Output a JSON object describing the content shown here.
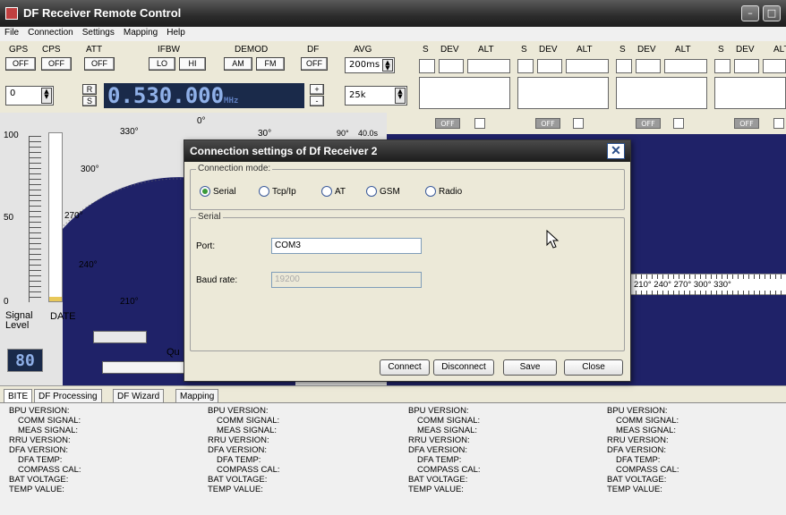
{
  "window": {
    "title": "DF Receiver Remote Control"
  },
  "menu": [
    "File",
    "Connection",
    "Settings",
    "Mapping",
    "Help"
  ],
  "toolbar": {
    "labels": [
      "GPS",
      "CPS",
      "ATT",
      "IFBW",
      "DEMOD",
      "DF",
      "AVG"
    ],
    "gps_btn": "OFF",
    "cps_btn": "OFF",
    "att_btn": "OFF",
    "lo": "LO",
    "hi": "HI",
    "am": "AM",
    "fm": "FM",
    "df_btn": "OFF",
    "avg_value": "200ms",
    "channel_value": "0",
    "r_label": "R",
    "s_label": "S",
    "frequency": "0.530.000",
    "freq_unit": "MHz",
    "step_value": "25k",
    "plus": "+",
    "minus": "-"
  },
  "channels": {
    "headers": [
      "S",
      "DEV",
      "ALT"
    ],
    "off_label": "OFF"
  },
  "compass": {
    "deg_0": "0°",
    "deg_30": "30°",
    "deg_330": "330°",
    "deg_300": "300°",
    "deg_270": "270°",
    "deg_240": "240°",
    "deg_210": "210°",
    "deg_90": "90°",
    "time": "40.0s"
  },
  "level": {
    "scale_100": "100",
    "scale_50": "50",
    "scale_0": "0",
    "signal_label": "Signal\nLevel",
    "date_label": "DATE",
    "level_value": "80",
    "quality_label": "Qu"
  },
  "scale_strip": "210° 240° 270° 300° 330°",
  "tabs": [
    "BITE",
    "DF Processing",
    "DF Wizard",
    "Mapping"
  ],
  "bite": {
    "lines": [
      "BPU VERSION:",
      "COMM SIGNAL:",
      "MEAS SIGNAL:",
      "RRU VERSION:",
      "DFA VERSION:",
      "DFA TEMP:",
      "COMPASS CAL:",
      "BAT VOLTAGE:",
      "TEMP VALUE:"
    ]
  },
  "dialog": {
    "title": "Connection settings of Df Receiver 2",
    "mode_label": "Connection mode:",
    "modes": [
      "Serial",
      "Tcp/Ip",
      "AT",
      "GSM",
      "Radio"
    ],
    "selected_mode": "Serial",
    "serial_group": "Serial",
    "port_label": "Port:",
    "port_value": "COM3",
    "baud_label": "Baud rate:",
    "baud_value": "19200",
    "buttons": {
      "connect": "Connect",
      "disconnect": "Disconnect",
      "save": "Save",
      "close": "Close"
    },
    "close_icon": "close-icon"
  },
  "colors": {
    "scope_bg": "#1f2268",
    "titlebar": "#2c2c2c",
    "radio_on": "#3a9a3a"
  }
}
